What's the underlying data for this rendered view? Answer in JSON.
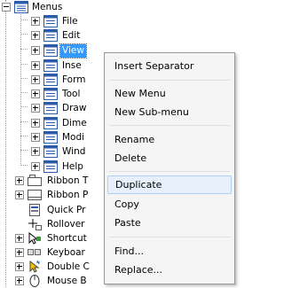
{
  "tree": {
    "root": {
      "label": "Menus",
      "icon": "menu-folder-icon"
    },
    "menu_children": [
      {
        "label": "File",
        "selected": false
      },
      {
        "label": "Edit",
        "selected": false
      },
      {
        "label": "View",
        "selected": true
      },
      {
        "label": "Inse",
        "selected": false
      },
      {
        "label": "Form",
        "selected": false
      },
      {
        "label": "Tool",
        "selected": false
      },
      {
        "label": "Draw",
        "selected": false
      },
      {
        "label": "Dime",
        "selected": false
      },
      {
        "label": "Modi",
        "selected": false
      },
      {
        "label": "Wind",
        "selected": false
      },
      {
        "label": "Help",
        "selected": false
      }
    ],
    "siblings": [
      {
        "label": "Ribbon T",
        "icon": "ribbon-icon",
        "expandable": true
      },
      {
        "label": "Ribbon P",
        "icon": "ribbon-panel-icon",
        "expandable": true
      },
      {
        "label": "Quick Pr",
        "icon": "quick-properties-icon",
        "expandable": false
      },
      {
        "label": "Rollover",
        "icon": "rollover-icon",
        "expandable": false
      },
      {
        "label": "Shortcut",
        "icon": "shortcut-icon",
        "expandable": true
      },
      {
        "label": "Keyboar",
        "icon": "keyboard-icon",
        "expandable": true
      },
      {
        "label": "Double C",
        "icon": "double-click-icon",
        "expandable": true
      },
      {
        "label": "Mouse B",
        "icon": "mouse-icon",
        "expandable": true
      }
    ]
  },
  "context_menu": {
    "items": [
      {
        "label": "Insert Separator",
        "hover": false
      },
      {
        "label": "New Menu",
        "hover": false
      },
      {
        "label": "New Sub-menu",
        "hover": false
      },
      {
        "label": "Rename",
        "hover": false
      },
      {
        "label": "Delete",
        "hover": false
      },
      {
        "label": "Duplicate",
        "hover": true
      },
      {
        "label": "Copy",
        "hover": false
      },
      {
        "label": "Paste",
        "hover": false
      },
      {
        "label": "Find...",
        "hover": false
      },
      {
        "label": "Replace...",
        "hover": false
      }
    ]
  },
  "colors": {
    "selection": "#3399ff",
    "menu_icon_blue": "#2b5aa8",
    "hover_bg": "#e8f1fb",
    "hover_border": "#aecff7"
  }
}
